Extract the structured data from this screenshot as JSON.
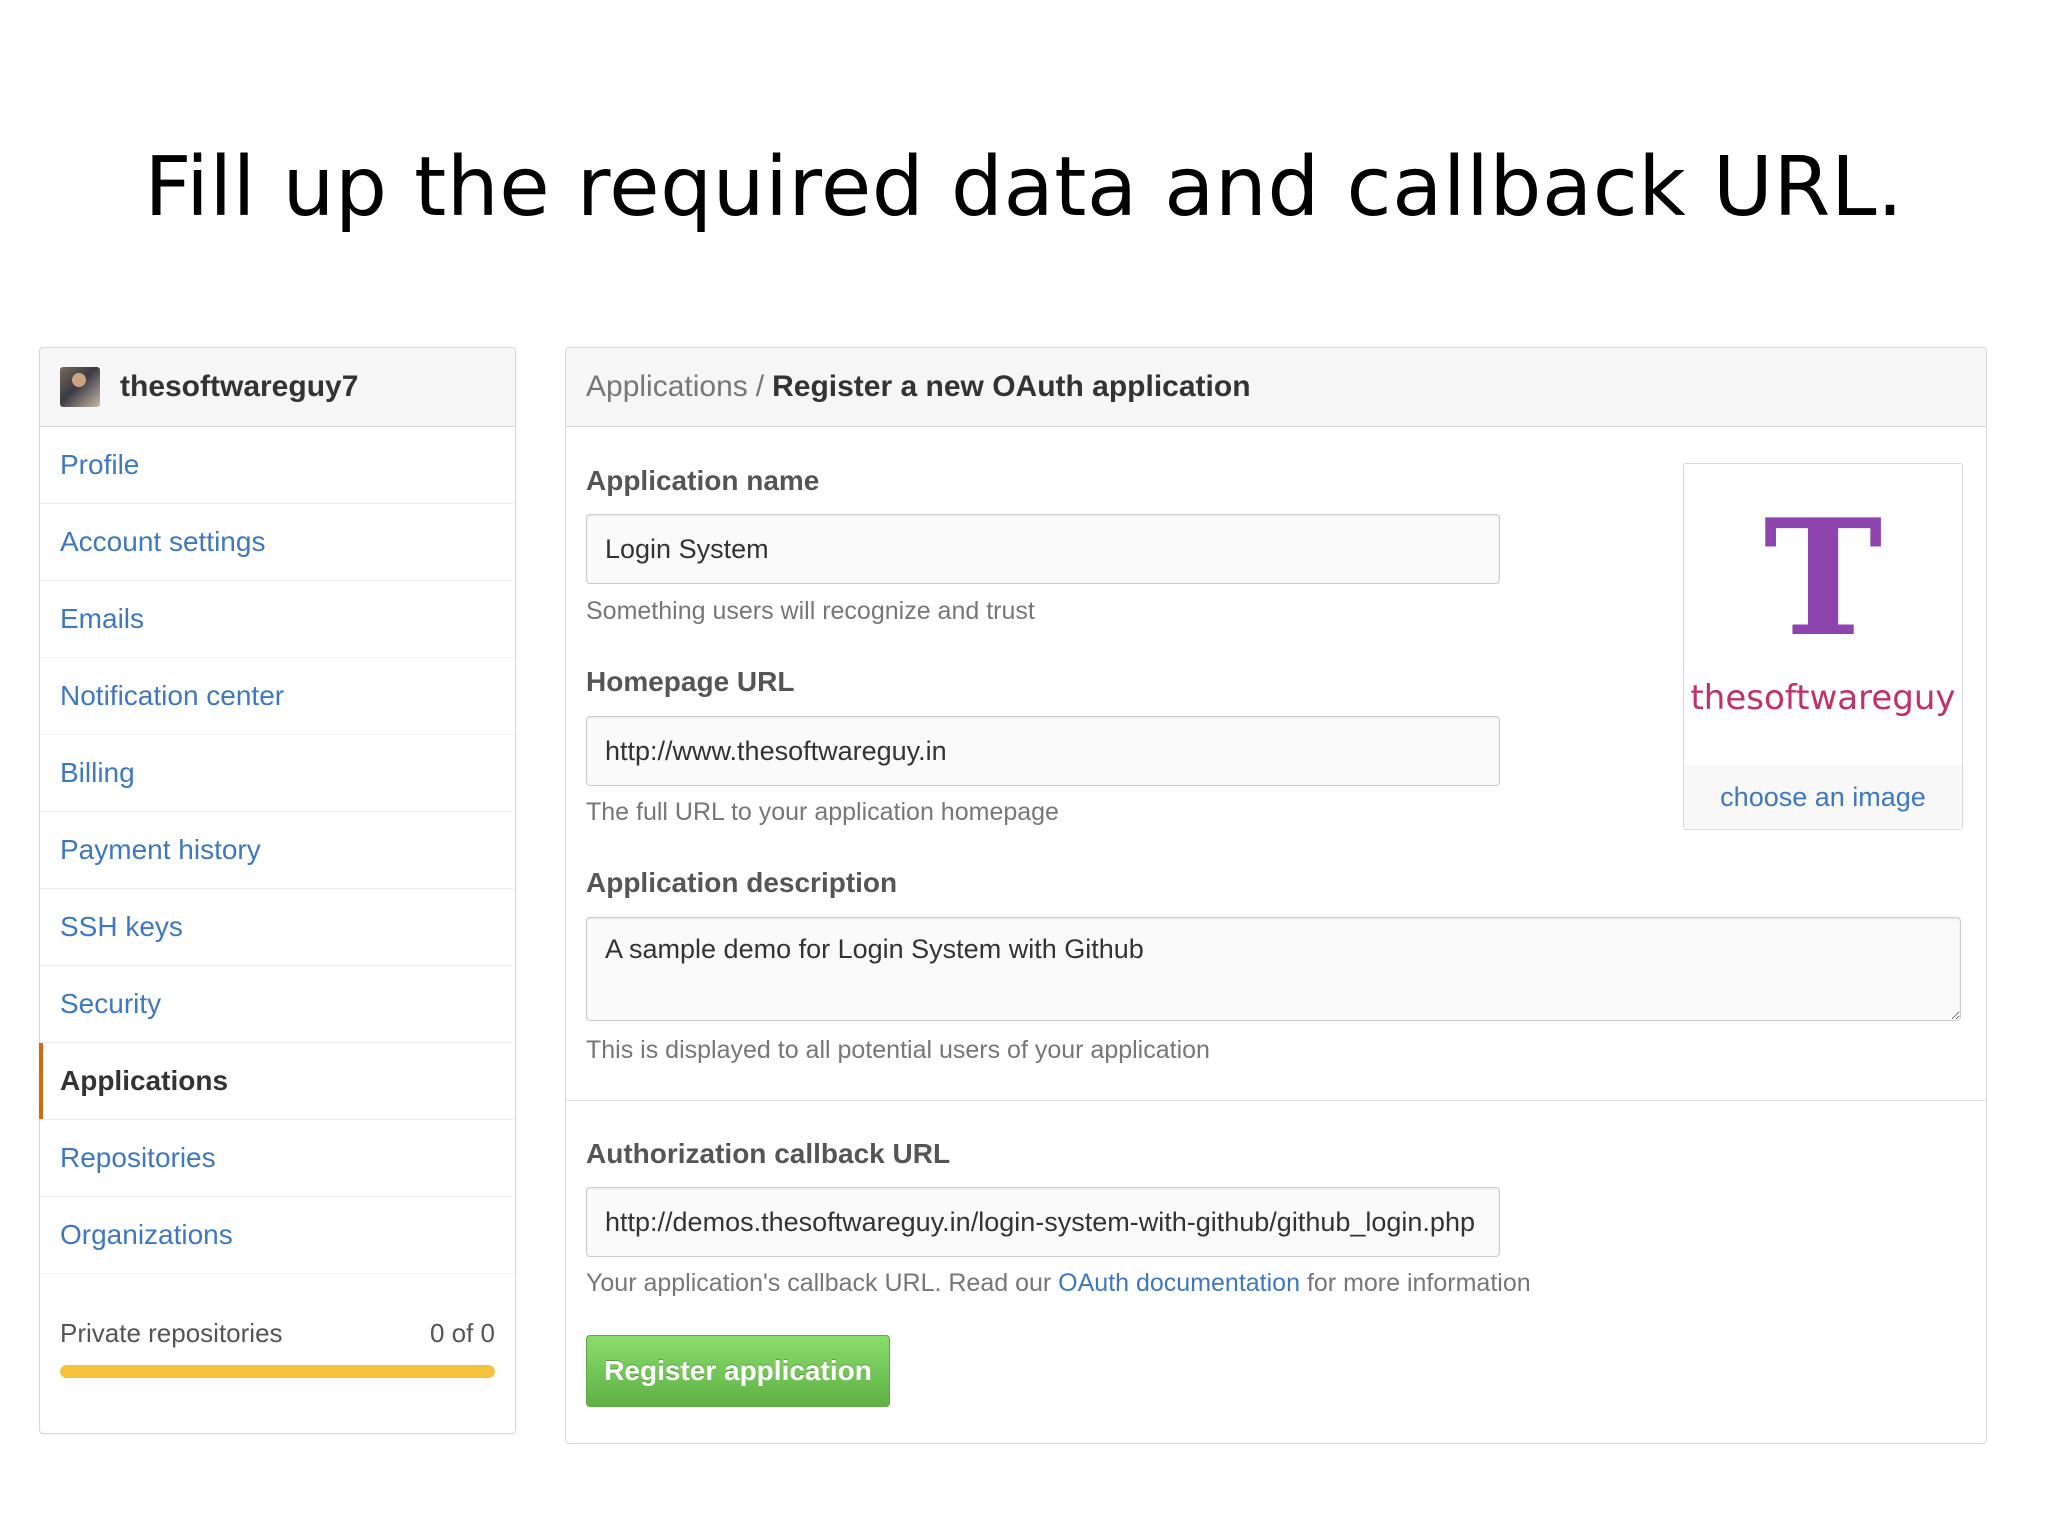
{
  "slide": {
    "title": "Fill up the required data and callback URL."
  },
  "sidebar": {
    "username": "thesoftwareguy7",
    "items": [
      {
        "label": "Profile"
      },
      {
        "label": "Account settings"
      },
      {
        "label": "Emails"
      },
      {
        "label": "Notification center"
      },
      {
        "label": "Billing"
      },
      {
        "label": "Payment history"
      },
      {
        "label": "SSH keys"
      },
      {
        "label": "Security"
      },
      {
        "label": "Applications",
        "active": true
      },
      {
        "label": "Repositories"
      },
      {
        "label": "Organizations"
      }
    ],
    "private_repos": {
      "label": "Private repositories",
      "value": "0 of 0",
      "fill_fraction": 1.0
    },
    "colors": {
      "link": "#4078c0",
      "active_marker": "#d26911",
      "progress": "#f5c33b"
    }
  },
  "main": {
    "breadcrumb": {
      "parent": "Applications",
      "separator": "/",
      "current": "Register a new OAuth application"
    },
    "app_name": {
      "label": "Application name",
      "value": "Login System",
      "note": "Something users will recognize and trust"
    },
    "homepage": {
      "label": "Homepage URL",
      "value": "http://www.thesoftwareguy.in",
      "note": "The full URL to your application homepage"
    },
    "description": {
      "label": "Application description",
      "value": "A sample demo for Login System with Github",
      "note": "This is displayed to all potential users of your application"
    },
    "callback": {
      "label": "Authorization callback URL",
      "value": "http://demos.thesoftwareguy.in/login-system-with-github/github_login.php",
      "note_before": "Your application's callback URL. Read our ",
      "note_link": "OAuth documentation",
      "note_after": " for more information"
    },
    "logo": {
      "wordmark": "thesoftwareguy",
      "letter": "T",
      "choose_label": "choose an image",
      "color": "#8e44ad"
    },
    "register_button": "Register application",
    "colors": {
      "button": "#60b044"
    }
  }
}
